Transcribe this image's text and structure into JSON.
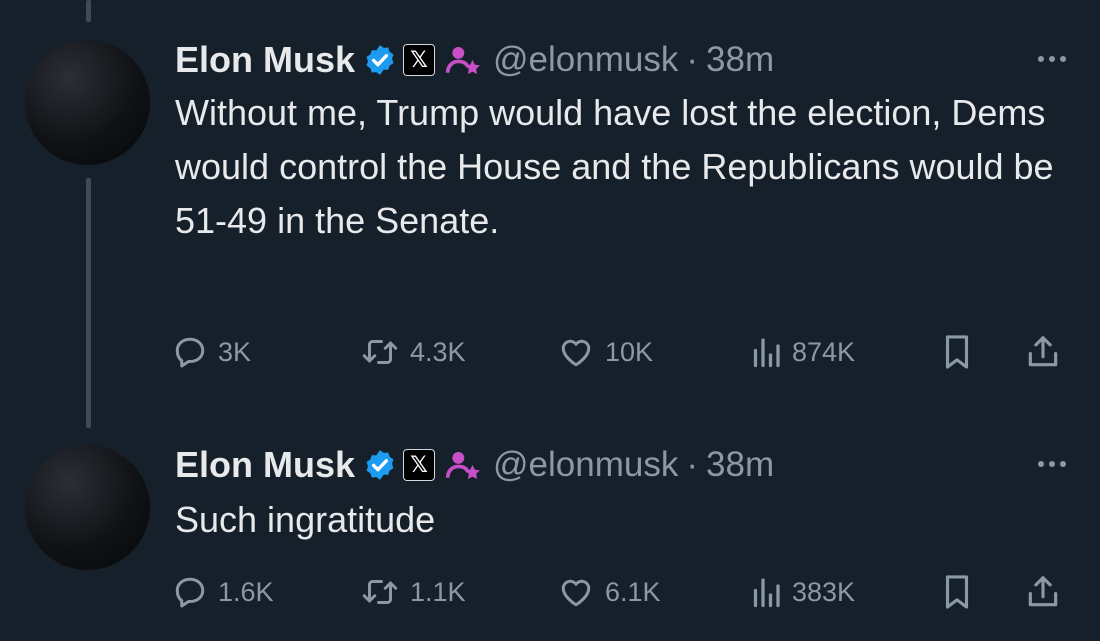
{
  "tweets": [
    {
      "name": "Elon Musk",
      "x_label": "𝕏",
      "handle": "@elonmusk",
      "separator": "·",
      "time": "38m",
      "text": "Without me, Trump would have lost the election, Dems would control the House and the Republicans would be 51-49 in the Senate.",
      "replies": "3K",
      "reposts": "4.3K",
      "likes": "10K",
      "views": "874K"
    },
    {
      "name": "Elon Musk",
      "x_label": "𝕏",
      "handle": "@elonmusk",
      "separator": "·",
      "time": "38m",
      "text": "Such ingratitude",
      "replies": "1.6K",
      "reposts": "1.1K",
      "likes": "6.1K",
      "views": "383K"
    }
  ],
  "colors": {
    "background": "#15202b",
    "text": "#e7e9ea",
    "secondary": "#8b98a5",
    "verified": "#1d9bf0",
    "affiliate": "#c94fc9"
  }
}
